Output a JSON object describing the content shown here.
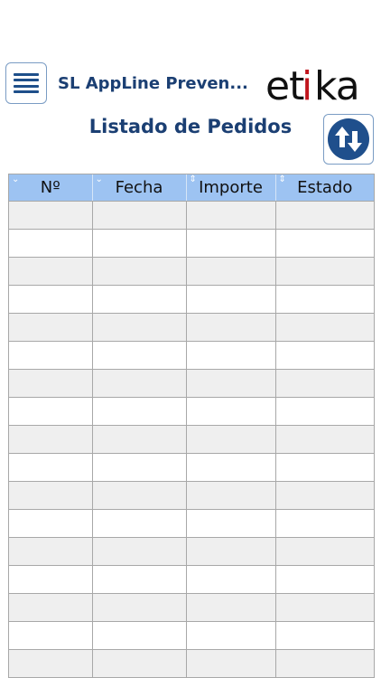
{
  "header": {
    "app_title": "SL AppLine Preven...",
    "logo_text": "etika"
  },
  "page": {
    "title": "Listado de Pedidos"
  },
  "table": {
    "columns": [
      {
        "label": "Nº",
        "sort": "desc"
      },
      {
        "label": "Fecha",
        "sort": "desc"
      },
      {
        "label": "Importe",
        "sort": "both"
      },
      {
        "label": "Estado",
        "sort": "both"
      }
    ],
    "row_count_visible": 17
  },
  "colors": {
    "header_bg": "#9dc3f2",
    "title_color": "#1b3f73",
    "accent": "#1e4f8a",
    "logo_red": "#c0151d"
  },
  "icons": {
    "menu": "hamburger-menu-icon",
    "sort": "sort-up-down-icon"
  }
}
